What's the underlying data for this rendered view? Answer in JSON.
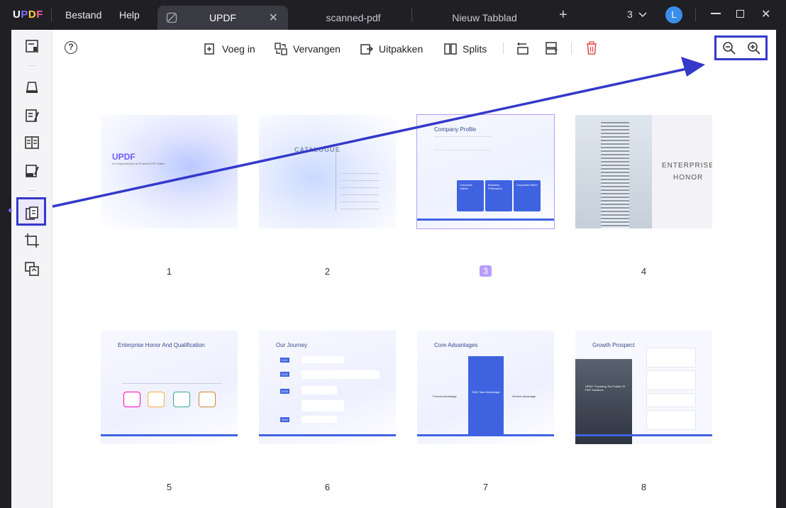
{
  "app": {
    "logo": "UPDF",
    "menu": [
      "Bestand",
      "Help"
    ],
    "tabs": [
      {
        "label": "UPDF",
        "active": true
      },
      {
        "label": "scanned-pdf",
        "active": false
      },
      {
        "label": "Nieuw Tabblad",
        "active": false
      }
    ],
    "tab_count": "3",
    "avatar_letter": "L"
  },
  "toolbar": {
    "insert_label": "Voeg in",
    "replace_label": "Vervangen",
    "extract_label": "Uitpakken",
    "split_label": "Splits"
  },
  "pages": [
    {
      "number": "1",
      "title": "UPDF",
      "subtitle": "A Comprehensive AI-Powered PDF Editor"
    },
    {
      "number": "2",
      "title": "CATALOGUE"
    },
    {
      "number": "3",
      "title": "Company Profile",
      "cards": [
        "Corporate Values",
        "Business Philosophy",
        "Corporate Vision"
      ],
      "selected": true
    },
    {
      "number": "4",
      "title": "ENTERPRISE",
      "title2": "HONOR"
    },
    {
      "number": "5",
      "title": "Enterprise Honor And Qualification"
    },
    {
      "number": "6",
      "title": "Our Journey",
      "years": [
        "2021",
        "2022",
        "2023",
        "2024"
      ],
      "months": [
        "AUG",
        "JUL",
        "MAR",
        "JUL",
        "APR"
      ]
    },
    {
      "number": "7",
      "title": "Core Advantages",
      "center": "R&D Team Advantage",
      "left": "Product Advantage",
      "right": "Service Advantage"
    },
    {
      "number": "8",
      "title": "Growth Prospect",
      "caption": "UPDF: Powering The Future Of PDF Solutions"
    }
  ],
  "colors": {
    "accent": "#7b5cff",
    "highlight": "#3439c9",
    "selected_badge": "#b89cff",
    "delete": "#e5484d"
  }
}
